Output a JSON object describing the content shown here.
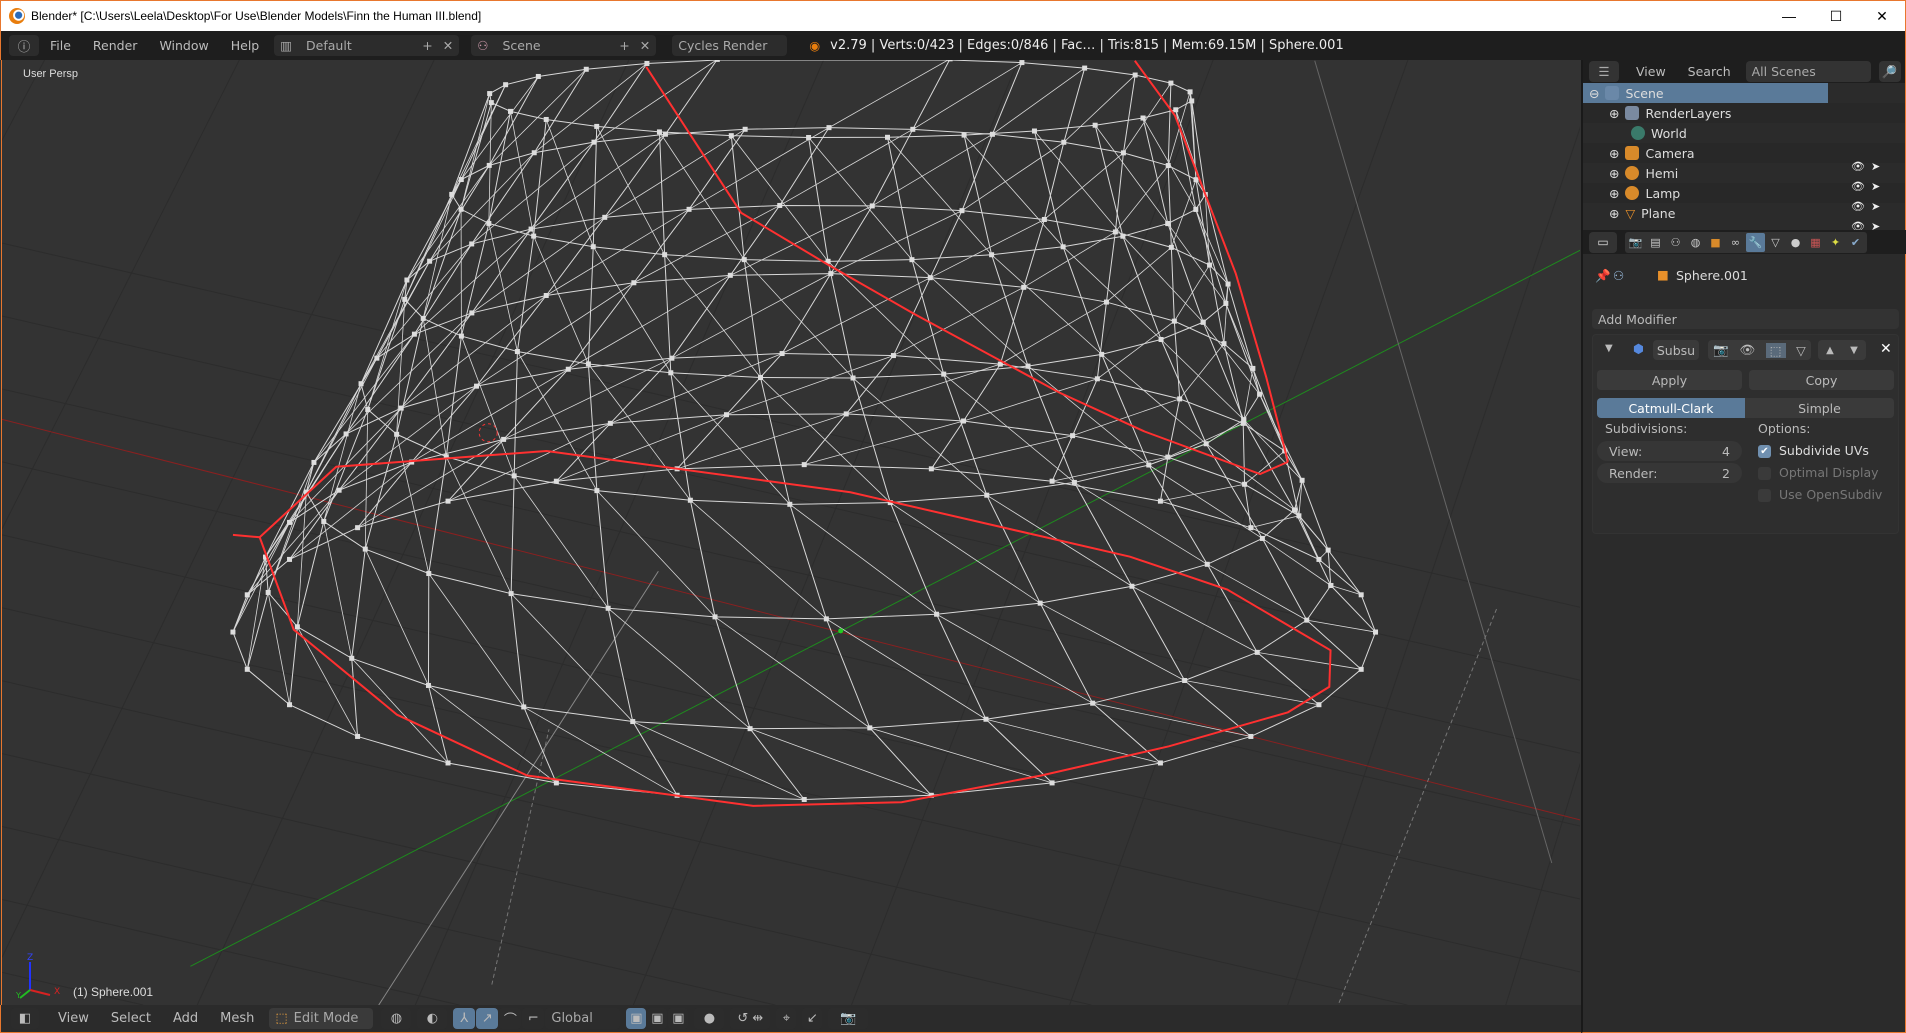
{
  "window": {
    "title": "Blender* [C:\\Users\\Leela\\Desktop\\For Use\\Blender Models\\Finn the Human III.blend]",
    "minimize": "—",
    "maximize": "☐",
    "close": "✕"
  },
  "topbar": {
    "menus": [
      "File",
      "Render",
      "Window",
      "Help"
    ],
    "layout": "Default",
    "scene": "Scene",
    "engine": "Cycles Render",
    "stats": "v2.79 | Verts:0/423 | Edges:0/846 | Fac… | Tris:815 | Mem:69.15M | Sphere.001"
  },
  "viewport": {
    "view_label": "User Persp",
    "object_label": "(1) Sphere.001",
    "axis_x": "X",
    "axis_y": "Y",
    "axis_z": "Z",
    "colors": {
      "background": "#333333",
      "selected_edge": "#ff3030",
      "wire": "#d8d8d8",
      "x_axis": "#8a2020",
      "y_axis": "#1e8a1e"
    }
  },
  "bottombar": {
    "menus": [
      "View",
      "Select",
      "Add",
      "Mesh"
    ],
    "mode": "Edit Mode",
    "orientation": "Global"
  },
  "outliner": {
    "menus": [
      "View",
      "Search"
    ],
    "filter": "All Scenes",
    "items": [
      {
        "label": "Scene",
        "selected": true
      },
      {
        "label": "RenderLayers"
      },
      {
        "label": "World"
      },
      {
        "label": "Camera"
      },
      {
        "label": "Hemi"
      },
      {
        "label": "Lamp"
      },
      {
        "label": "Plane"
      }
    ]
  },
  "properties": {
    "object": "Sphere.001",
    "add_modifier": "Add Modifier",
    "modifier_name": "Subsu",
    "apply": "Apply",
    "copy": "Copy",
    "types": [
      "Catmull-Clark",
      "Simple"
    ],
    "active_type": "Catmull-Clark",
    "subdivisions_label": "Subdivisions:",
    "view_label": "View:",
    "view_value": "4",
    "render_label": "Render:",
    "render_value": "2",
    "options_label": "Options:",
    "options": [
      {
        "label": "Subdivide UVs",
        "checked": true
      },
      {
        "label": "Optimal Display",
        "checked": false
      },
      {
        "label": "Use OpenSubdiv",
        "checked": false
      }
    ]
  }
}
